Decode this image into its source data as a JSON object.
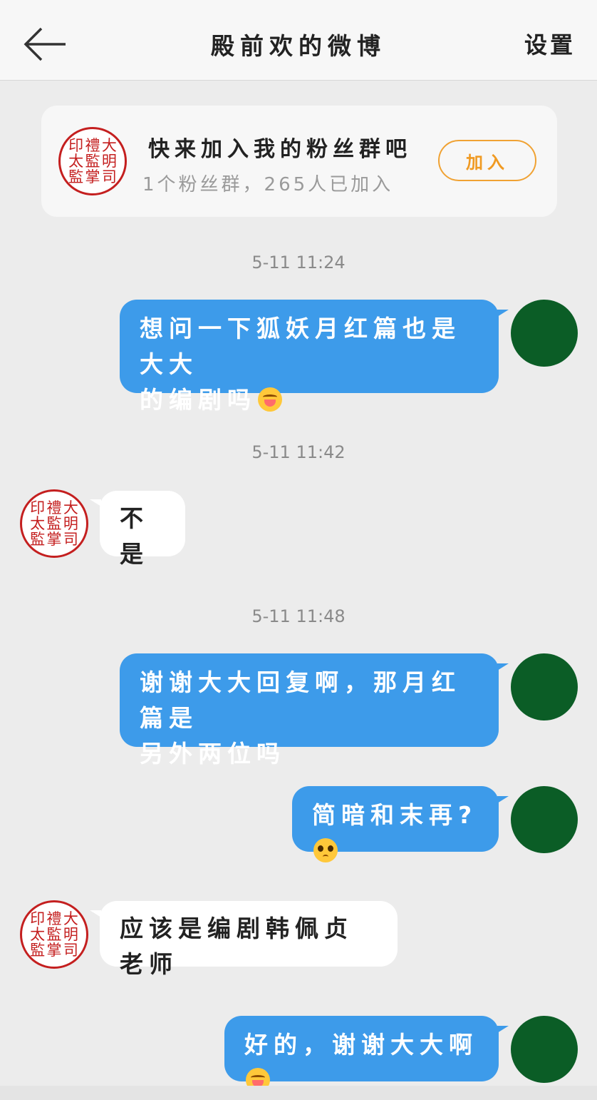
{
  "header": {
    "title": "殿前欢的微博",
    "settings_label": "设置"
  },
  "fan_group": {
    "title": "快来加入我的粉丝群吧",
    "subtitle": "1个粉丝群，265人已加入",
    "join_label": "加入",
    "accent_color": "#f0a233"
  },
  "seal_text": [
    "大",
    "禮",
    "印",
    "明",
    "監",
    "太",
    "司",
    "掌",
    "監"
  ],
  "colors": {
    "my_bubble": "#3d9bea",
    "other_bubble": "#ffffff",
    "my_avatar": "#0b5d26",
    "seal": "#c41f1f"
  },
  "messages": {
    "t1": "5-11 11:24",
    "m1_line1": "想问一下狐妖月红篇也是大大",
    "m1_line2": "的编剧吗",
    "t2": "5-11 11:42",
    "m2": "不是",
    "t3": "5-11 11:48",
    "m3_line1": "谢谢大大回复啊，那月红篇是",
    "m3_line2": "另外两位吗",
    "m4": "简暗和末再?",
    "m5": "应该是编剧韩佩贞老师",
    "m6": "好的，谢谢大大啊"
  },
  "emoji": {
    "m1": "hug-emoji",
    "m4": "pleading-emoji",
    "m6": "hug-emoji"
  }
}
